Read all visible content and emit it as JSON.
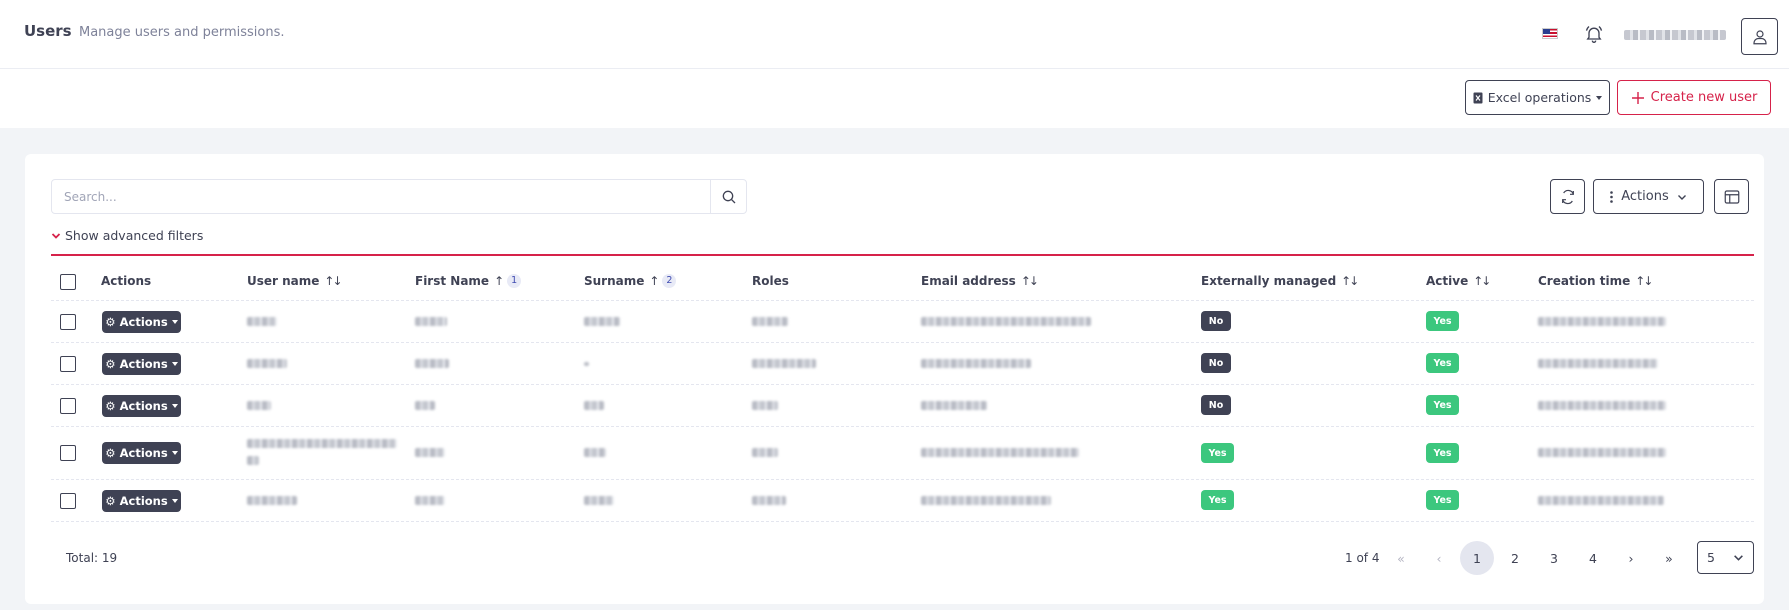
{
  "header": {
    "title": "Users",
    "subtitle": "Manage users and permissions."
  },
  "toolbar": {
    "excel_label": "Excel operations",
    "create_label": "Create new user"
  },
  "search": {
    "placeholder": "Search...",
    "value": ""
  },
  "table_tools": {
    "actions_label": "Actions"
  },
  "filters": {
    "advanced_label": "Show advanced filters"
  },
  "table": {
    "columns": {
      "actions": "Actions",
      "user_name": "User name",
      "first_name": "First Name",
      "first_name_order": "1",
      "surname": "Surname",
      "surname_order": "2",
      "roles": "Roles",
      "email": "Email address",
      "externally_managed": "Externally managed",
      "active": "Active",
      "creation_time": "Creation time"
    },
    "row_action_label": "Actions",
    "rows": [
      {
        "externally_managed": "No",
        "active": "Yes"
      },
      {
        "externally_managed": "No",
        "active": "Yes"
      },
      {
        "externally_managed": "No",
        "active": "Yes"
      },
      {
        "externally_managed": "Yes",
        "active": "Yes"
      },
      {
        "externally_managed": "Yes",
        "active": "Yes"
      }
    ]
  },
  "footer": {
    "total": "Total: 19",
    "page_info": "1 of 4",
    "first": "«",
    "prev": "‹",
    "pages": [
      "1",
      "2",
      "3",
      "4"
    ],
    "next": "›",
    "last": "»",
    "page_size": "5"
  },
  "colors": {
    "accent": "#d6224a",
    "dark": "#3f4254",
    "success": "#3cc77e"
  }
}
